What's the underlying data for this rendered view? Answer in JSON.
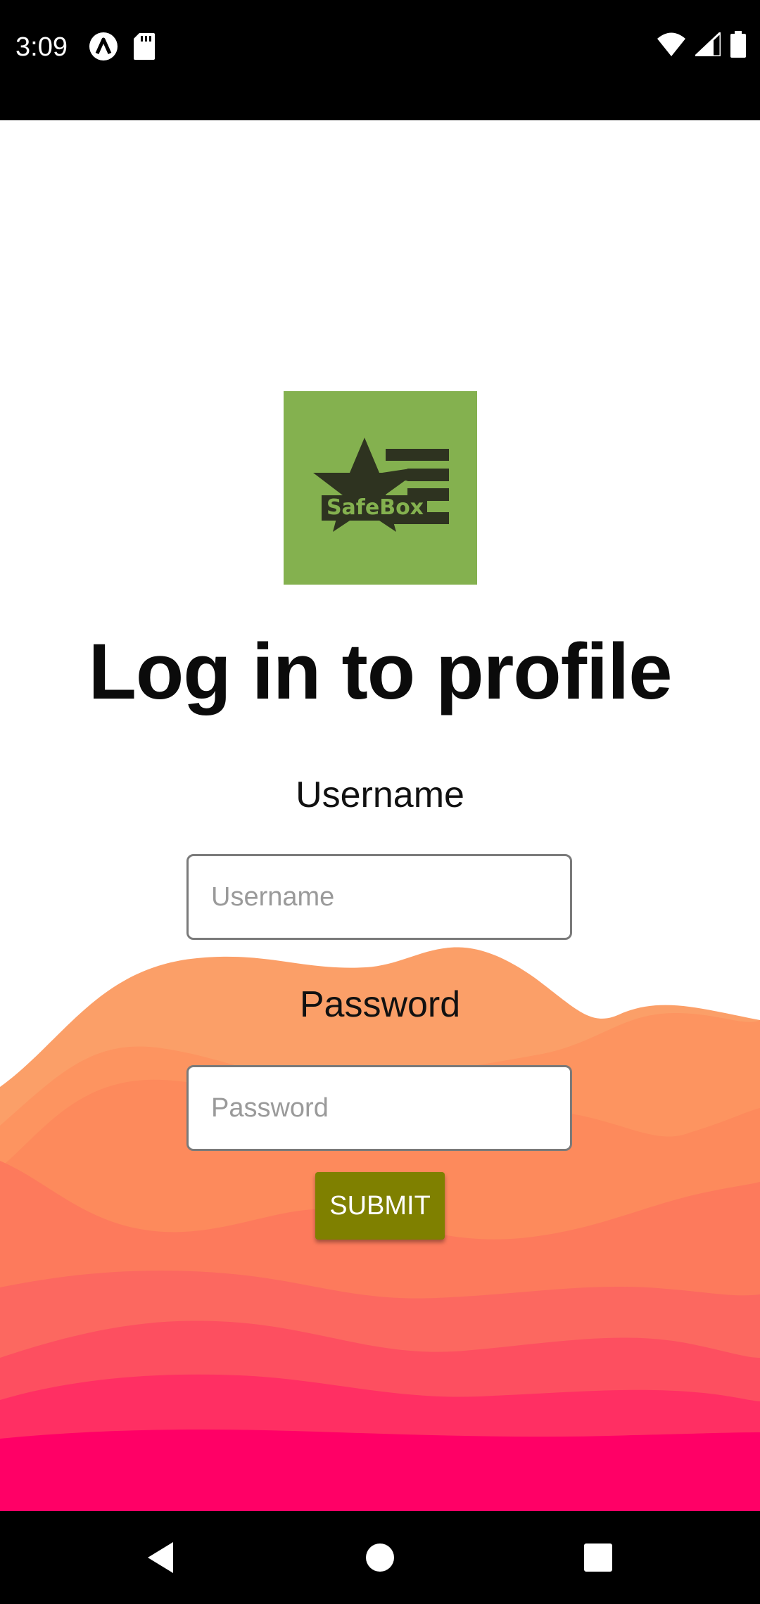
{
  "status_bar": {
    "time": "3:09",
    "left_icons": [
      "app-notification-icon",
      "sd-card-icon"
    ],
    "right_icons": [
      "wifi-icon",
      "cellular-signal-icon",
      "battery-icon"
    ]
  },
  "logo": {
    "brand_text": "SafeBox",
    "background_color": "#84b14f",
    "foreground_color": "#2e3320"
  },
  "page": {
    "title": "Log in to profile"
  },
  "form": {
    "username_label": "Username",
    "username_placeholder": "Username",
    "username_value": "",
    "password_label": "Password",
    "password_placeholder": "Password",
    "password_value": "",
    "submit_label": "SUBMIT",
    "submit_color": "#7f8000"
  },
  "nav_bar": {
    "icons": [
      "back-icon",
      "home-icon",
      "recents-icon"
    ]
  },
  "colors": {
    "wave_top": "#fb9f68",
    "wave_mid": "#fc6d5c",
    "wave_bottom": "#ff0066"
  }
}
